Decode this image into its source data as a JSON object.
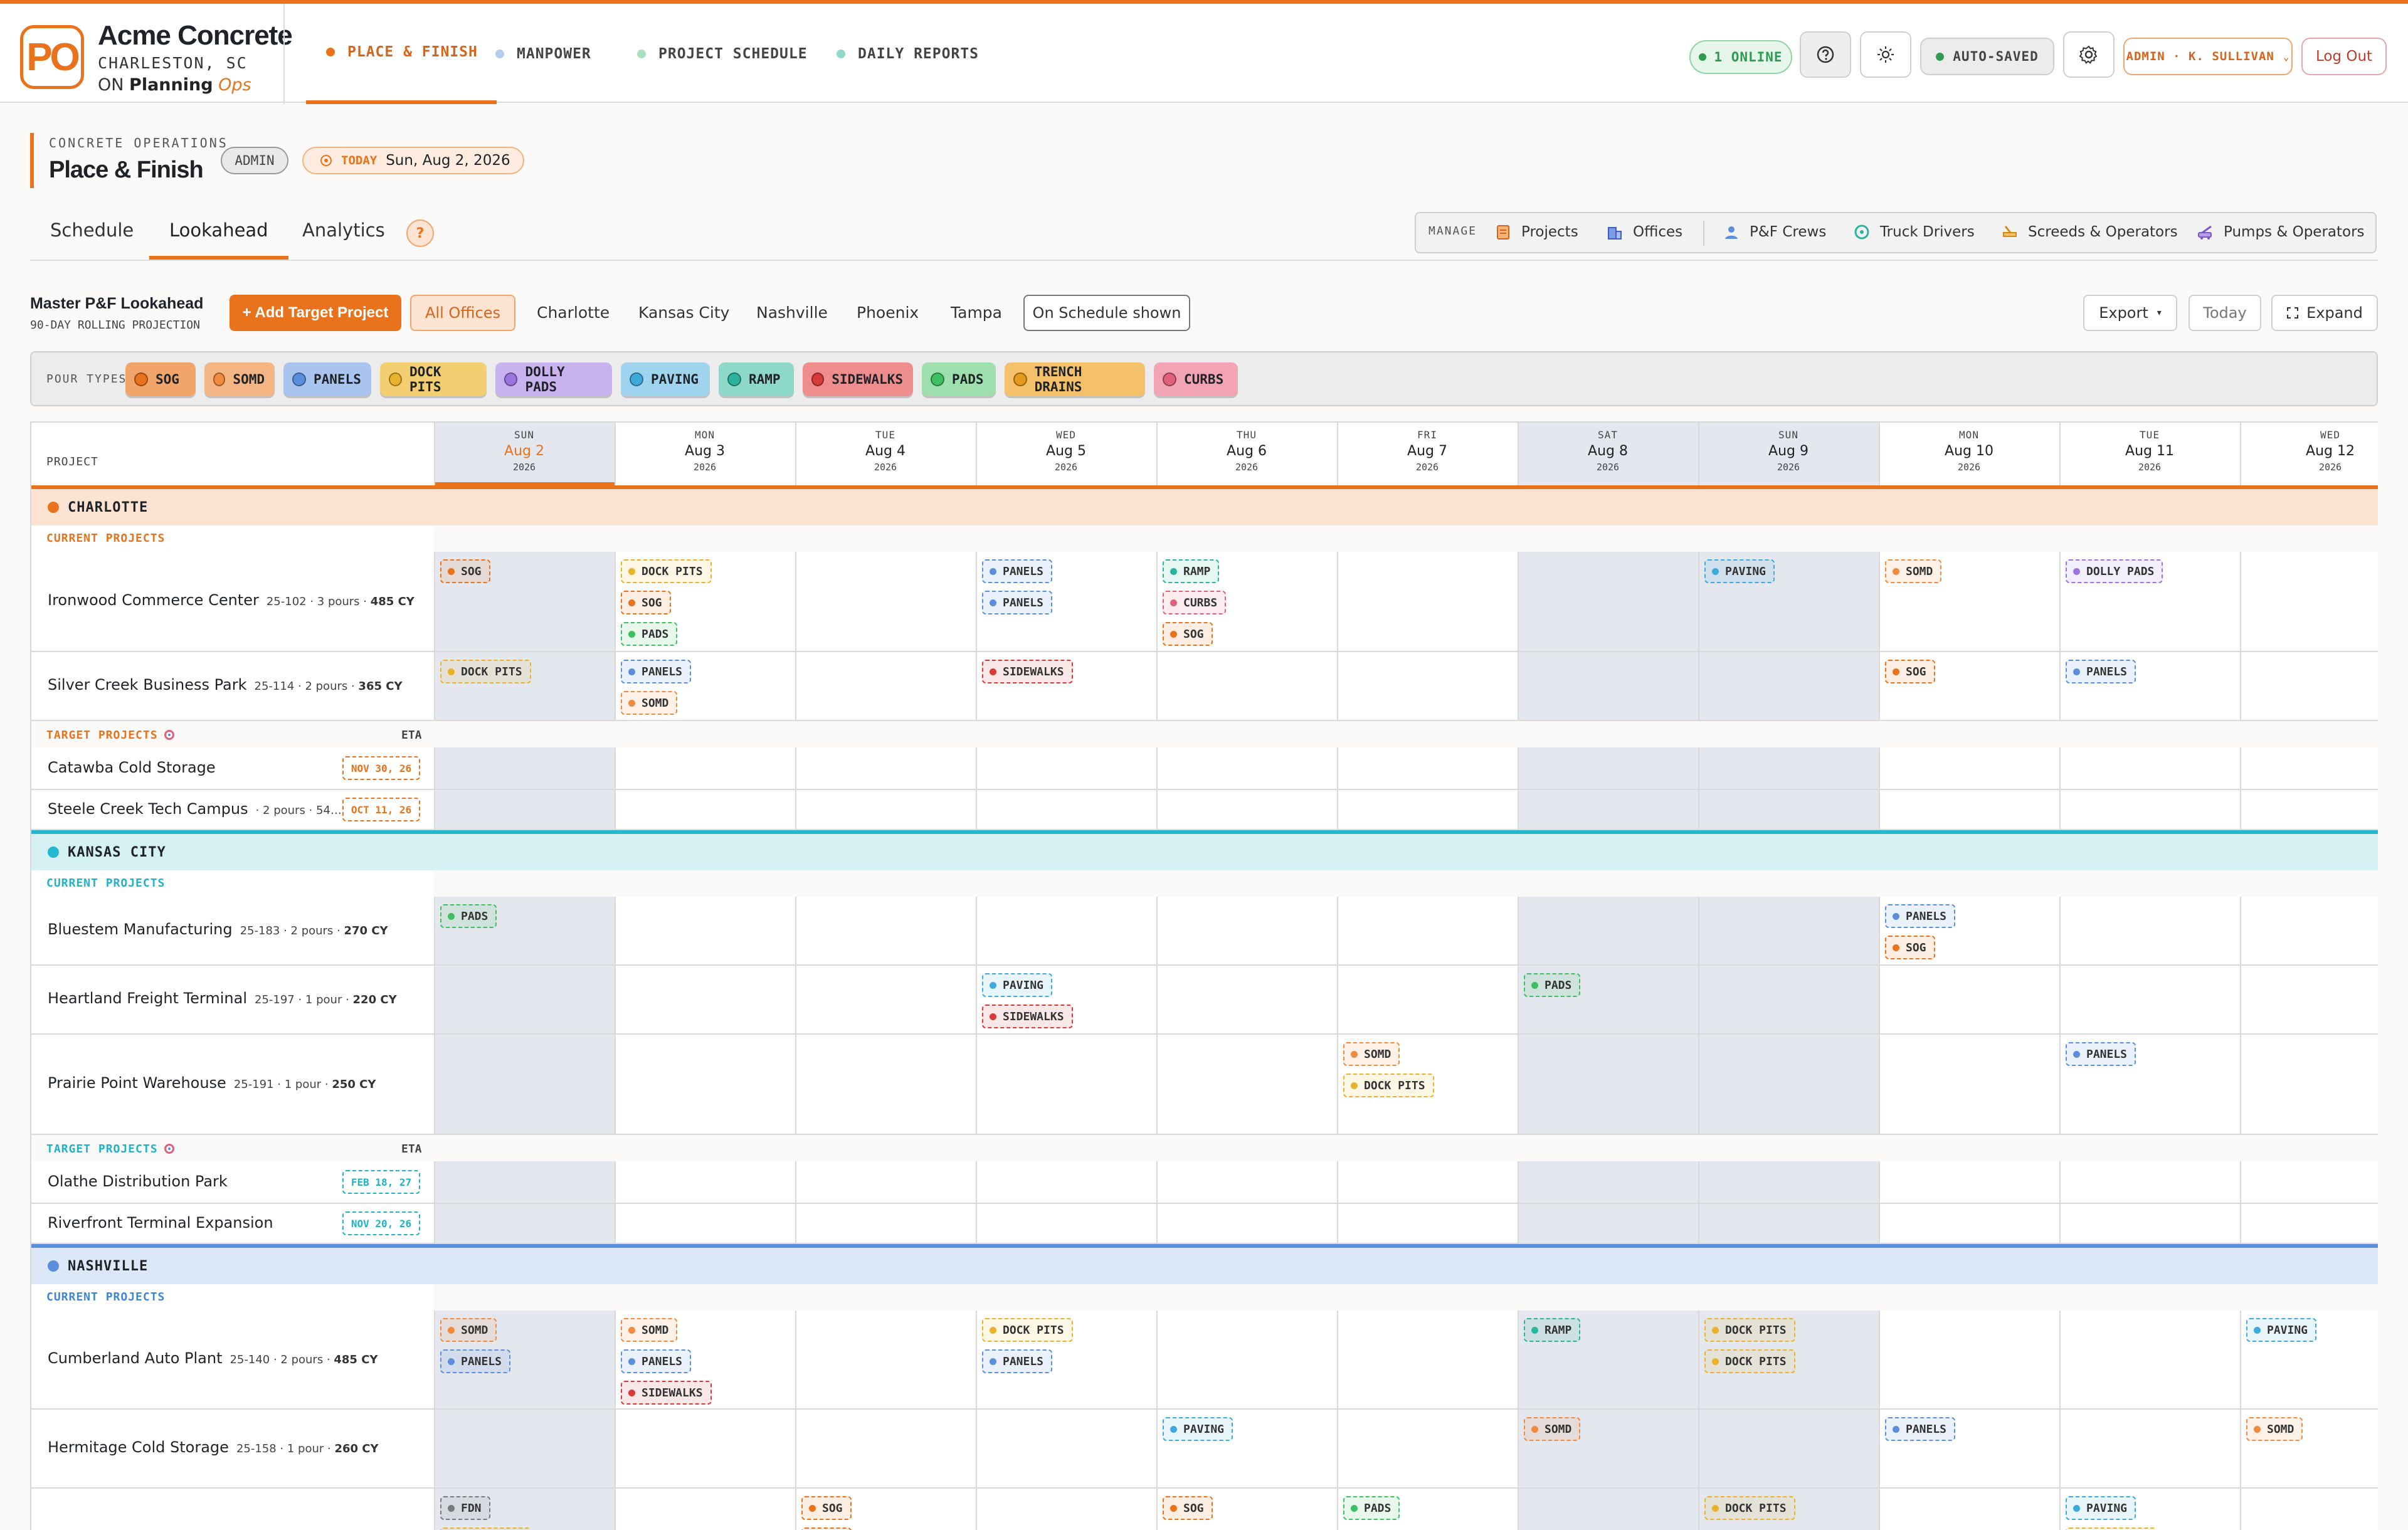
{
  "brand": {
    "name": "Acme Concrete",
    "location": "CHARLESTON, SC",
    "on_prefix": "ON",
    "product": "Planning",
    "product_accent": "Ops",
    "logo_text": "PO"
  },
  "nav": [
    {
      "label": "PLACE & FINISH",
      "active": true,
      "color": "#e8731c"
    },
    {
      "label": "MANPOWER",
      "active": false,
      "color": "#9ec3ea"
    },
    {
      "label": "PROJECT SCHEDULE",
      "active": false,
      "color": "#9ed9b4"
    },
    {
      "label": "DAILY REPORTS",
      "active": false,
      "color": "#7fd3c6"
    }
  ],
  "header_right": {
    "online": "1 ONLINE",
    "autosave": "AUTO-SAVED",
    "user": "ADMIN · K. SULLIVAN",
    "logout": "Log Out"
  },
  "page": {
    "kicker": "CONCRETE OPERATIONS",
    "title": "Place & Finish",
    "role": "ADMIN",
    "today_label": "TODAY",
    "today_date": "Sun, Aug 2, 2026"
  },
  "tabs": [
    "Schedule",
    "Lookahead",
    "Analytics"
  ],
  "help": "?",
  "manage": {
    "label": "MANAGE",
    "items": [
      "Projects",
      "Offices",
      "P&F Crews",
      "Truck Drivers",
      "Screeds & Operators",
      "Pumps & Operators"
    ]
  },
  "lookahead": {
    "title": "Master P&F Lookahead",
    "subtitle": "90-DAY ROLLING PROJECTION",
    "add_button": "+ Add Target Project",
    "offices": [
      "All Offices",
      "Charlotte",
      "Kansas City",
      "Nashville",
      "Phoenix",
      "Tampa"
    ],
    "toggle": "On Schedule shown",
    "export": "Export",
    "today": "Today",
    "expand": "Expand"
  },
  "pour_types": {
    "label": "POUR TYPES",
    "items": [
      {
        "name": "SOG",
        "bg": "#f2a56a",
        "dot": "#e8731c"
      },
      {
        "name": "SOMD",
        "bg": "#f3b584",
        "dot": "#ef8a3e"
      },
      {
        "name": "PANELS",
        "bg": "#a9c4ee",
        "dot": "#5b8fdc"
      },
      {
        "name": "DOCK PITS",
        "bg": "#f4cf72",
        "dot": "#e9b22c"
      },
      {
        "name": "DOLLY PADS",
        "bg": "#c8b3ee",
        "dot": "#9b74e0"
      },
      {
        "name": "PAVING",
        "bg": "#9fd3ee",
        "dot": "#3fa9dc"
      },
      {
        "name": "RAMP",
        "bg": "#8ed8c9",
        "dot": "#2bb39b"
      },
      {
        "name": "SIDEWALKS",
        "bg": "#ef8c8c",
        "dot": "#d83a3a"
      },
      {
        "name": "PADS",
        "bg": "#9fdfae",
        "dot": "#3fbf62"
      },
      {
        "name": "TRENCH DRAINS",
        "bg": "#f4c06a",
        "dot": "#e49a1c"
      },
      {
        "name": "CURBS",
        "bg": "#f2a3b4",
        "dot": "#e0607c"
      }
    ]
  },
  "colors": {
    "SOG": "#e8731c",
    "SOMD": "#ef8a3e",
    "PANELS": "#5b8fdc",
    "DOCK PITS": "#e9b22c",
    "DOLLY PADS": "#9b74e0",
    "PAVING": "#3fa9dc",
    "RAMP": "#2bb39b",
    "SIDEWALKS": "#d83a3a",
    "PADS": "#3fbf62",
    "TRENCH DRAINS": "#e49a1c",
    "CURBS": "#e0607c",
    "FDN": "#7a7a7a"
  },
  "grid": {
    "project_header": "PROJECT",
    "days": [
      {
        "dow": "SUN",
        "date": "Aug 2",
        "year": "2026",
        "today": true,
        "weekend": true
      },
      {
        "dow": "MON",
        "date": "Aug 3",
        "year": "2026"
      },
      {
        "dow": "TUE",
        "date": "Aug 4",
        "year": "2026"
      },
      {
        "dow": "WED",
        "date": "Aug 5",
        "year": "2026"
      },
      {
        "dow": "THU",
        "date": "Aug 6",
        "year": "2026"
      },
      {
        "dow": "FRI",
        "date": "Aug 7",
        "year": "2026"
      },
      {
        "dow": "SAT",
        "date": "Aug 8",
        "year": "2026",
        "weekend": true
      },
      {
        "dow": "SUN",
        "date": "Aug 9",
        "year": "2026",
        "weekend": true
      },
      {
        "dow": "MON",
        "date": "Aug 10",
        "year": "2026"
      },
      {
        "dow": "TUE",
        "date": "Aug 11",
        "year": "2026"
      },
      {
        "dow": "WED",
        "date": "Aug 12",
        "year": "2026"
      }
    ],
    "current_label": "CURRENT PROJECTS",
    "target_label": "TARGET PROJECTS",
    "eta_label": "ETA",
    "offices": [
      {
        "name": "CHARLOTTE",
        "color": "#e8731c",
        "band": "#fde3d1",
        "sub": "#e8731c",
        "current": [
          {
            "name": "Ironwood Commerce Center",
            "meta": "25-102 · 3 pours · ",
            "cy": "485 CY",
            "pours": [
              [
                0,
                [
                  "SOG"
                ]
              ],
              [
                1,
                [
                  "DOCK PITS",
                  "SOG",
                  "PADS"
                ]
              ],
              [
                3,
                [
                  "PANELS",
                  "PANELS"
                ]
              ],
              [
                4,
                [
                  "RAMP",
                  "CURBS",
                  "SOG"
                ]
              ],
              [
                7,
                [
                  "PAVING"
                ]
              ],
              [
                8,
                [
                  "SOMD"
                ]
              ],
              [
                9,
                [
                  "DOLLY PADS"
                ]
              ]
            ]
          },
          {
            "name": "Silver Creek Business Park",
            "meta": "25-114 · 2 pours · ",
            "cy": "365 CY",
            "pours": [
              [
                0,
                [
                  "DOCK PITS"
                ]
              ],
              [
                1,
                [
                  "PANELS",
                  "SOMD"
                ]
              ],
              [
                3,
                [
                  "SIDEWALKS"
                ]
              ],
              [
                8,
                [
                  "SOG"
                ]
              ],
              [
                9,
                [
                  "PANELS"
                ]
              ]
            ]
          }
        ],
        "target": [
          {
            "name": "Catawba Cold Storage",
            "meta": "",
            "eta": "NOV 30, 26"
          },
          {
            "name": "Steele Creek Tech Campus",
            "meta": "· 2 pours · 54…",
            "eta": "OCT 11, 26"
          }
        ]
      },
      {
        "name": "KANSAS CITY",
        "color": "#23b8cf",
        "band": "#d5f1f4",
        "sub": "#1eb3c9",
        "current": [
          {
            "name": "Bluestem Manufacturing",
            "meta": "25-183 · 2 pours · ",
            "cy": "270 CY",
            "pours": [
              [
                0,
                [
                  "PADS"
                ]
              ],
              [
                8,
                [
                  "PANELS",
                  "SOG"
                ]
              ]
            ]
          },
          {
            "name": "Heartland Freight Terminal",
            "meta": "25-197 · 1 pour · ",
            "cy": "220 CY",
            "pours": [
              [
                3,
                [
                  "PAVING",
                  "SIDEWALKS"
                ]
              ],
              [
                6,
                [
                  "PADS"
                ]
              ]
            ]
          },
          {
            "name": "Prairie Point Warehouse",
            "meta": "25-191 · 1 pour · ",
            "cy": "250 CY",
            "pours": [
              [
                5,
                [
                  "SOMD",
                  "DOCK PITS"
                ]
              ],
              [
                9,
                [
                  "PANELS"
                ]
              ]
            ]
          }
        ],
        "target": [
          {
            "name": "Olathe Distribution Park",
            "meta": "",
            "eta": "FEB 18, 27"
          },
          {
            "name": "Riverfront Terminal Expansion",
            "meta": "",
            "eta": "NOV 20, 26"
          }
        ]
      },
      {
        "name": "NASHVILLE",
        "color": "#5b8fdc",
        "band": "#dce8f8",
        "sub": "#3d86d6",
        "current": [
          {
            "name": "Cumberland Auto Plant",
            "meta": "25-140 · 2 pours · ",
            "cy": "485 CY",
            "pours": [
              [
                0,
                [
                  "SOMD",
                  "PANELS"
                ]
              ],
              [
                1,
                [
                  "SOMD",
                  "PANELS",
                  "SIDEWALKS"
                ]
              ],
              [
                3,
                [
                  "DOCK PITS",
                  "PANELS"
                ]
              ],
              [
                6,
                [
                  "RAMP"
                ]
              ],
              [
                7,
                [
                  "DOCK PITS",
                  "DOCK PITS"
                ]
              ],
              [
                10,
                [
                  "PAVING"
                ]
              ]
            ]
          },
          {
            "name": "Hermitage Cold Storage",
            "meta": "25-158 · 1 pour · ",
            "cy": "260 CY",
            "pours": [
              [
                4,
                [
                  "PAVING"
                ]
              ],
              [
                6,
                [
                  "SOMD"
                ]
              ],
              [
                8,
                [
                  "PANELS"
                ]
              ],
              [
                10,
                [
                  "SOMD"
                ]
              ]
            ]
          },
          {
            "name": "",
            "meta": "",
            "cy": "",
            "pours": [
              [
                0,
                [
                  "FDN",
                  "DOCK PITS"
                ]
              ],
              [
                2,
                [
                  "SOG",
                  "SOG"
                ]
              ],
              [
                4,
                [
                  "SOG"
                ]
              ],
              [
                5,
                [
                  "PADS"
                ]
              ],
              [
                7,
                [
                  "DOCK PITS"
                ]
              ],
              [
                9,
                [
                  "PAVING",
                  "DOCK PITS"
                ]
              ]
            ]
          }
        ],
        "target": []
      }
    ]
  }
}
